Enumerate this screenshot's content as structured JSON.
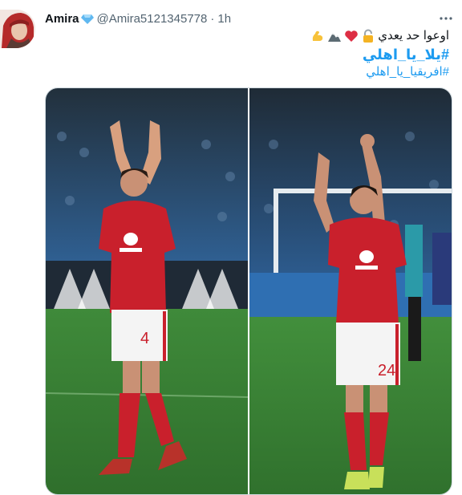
{
  "tweet": {
    "display_name": "Amira",
    "handle": "@Amira5121345778",
    "separator": "·",
    "time": "1h",
    "more_icon": "more-horizontal-icon",
    "verified_icon": "blue-diamond-icon",
    "text_line1": "اوعوا حد يعدي",
    "emojis": [
      "lock-icon",
      "red-heart-icon",
      "mountain-icon",
      "flexed-biceps-icon"
    ],
    "hashtag1": "#يلا_يا_اهلي",
    "hashtag2": "#افريقيا_يا_اهلي"
  },
  "media": {
    "photos": [
      {
        "kind": "player-photo",
        "shirt_number": "4",
        "sponsor": "ORGANI GROUP"
      },
      {
        "kind": "player-photo",
        "shirt_number": "24",
        "sponsor": "ORGANI GROUP"
      }
    ]
  },
  "colors": {
    "accent": "#1d9bf0",
    "text": "#0f1419",
    "secondary": "#536471",
    "kit_red": "#c9202c",
    "pitch_green": "#3f8a3a"
  }
}
